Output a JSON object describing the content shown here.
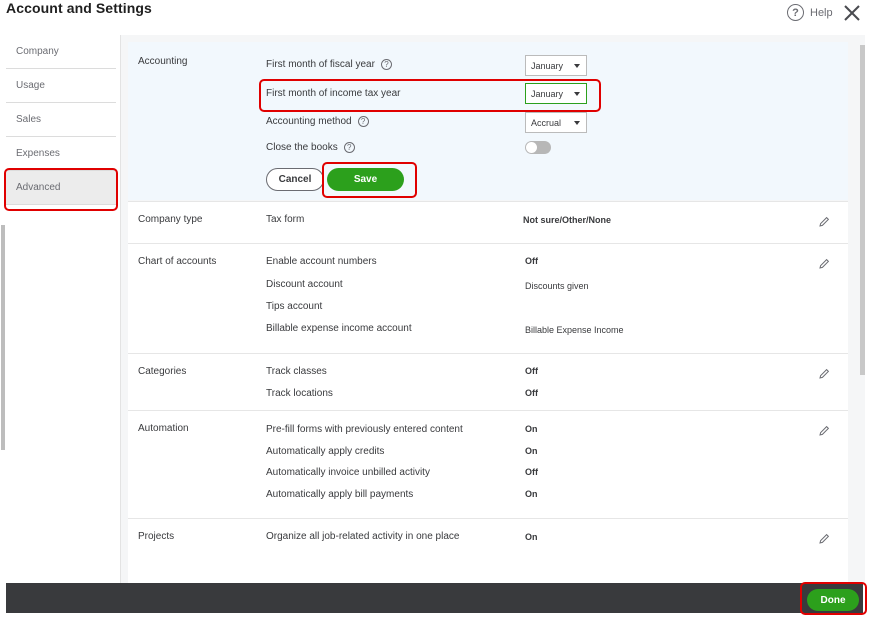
{
  "window": {
    "title": "Account and Settings",
    "help_label": "Help"
  },
  "sidebar": {
    "items": [
      {
        "label": "Company"
      },
      {
        "label": "Usage"
      },
      {
        "label": "Sales"
      },
      {
        "label": "Expenses"
      },
      {
        "label": "Advanced"
      }
    ]
  },
  "accounting": {
    "section_label": "Accounting",
    "fiscal_year_label": "First month of fiscal year",
    "fiscal_year_value": "January",
    "income_tax_label": "First month of income tax year",
    "income_tax_value": "January",
    "method_label": "Accounting method",
    "method_value": "Accrual",
    "close_books_label": "Close the books",
    "close_books_on": false,
    "cancel_label": "Cancel",
    "save_label": "Save"
  },
  "company_type": {
    "section_label": "Company type",
    "rows": [
      {
        "label": "Tax form",
        "value": "Not sure/Other/None"
      }
    ]
  },
  "chart_of_accounts": {
    "section_label": "Chart of accounts",
    "rows": [
      {
        "label": "Enable account numbers",
        "value": "Off"
      },
      {
        "label": "Discount account",
        "value": "Discounts given"
      },
      {
        "label": "Tips account",
        "value": ""
      },
      {
        "label": "Billable expense income account",
        "value": "Billable Expense Income"
      }
    ]
  },
  "categories": {
    "section_label": "Categories",
    "rows": [
      {
        "label": "Track classes",
        "value": "Off"
      },
      {
        "label": "Track locations",
        "value": "Off"
      }
    ]
  },
  "automation": {
    "section_label": "Automation",
    "rows": [
      {
        "label": "Pre-fill forms with previously entered content",
        "value": "On"
      },
      {
        "label": "Automatically apply credits",
        "value": "On"
      },
      {
        "label": "Automatically invoice unbilled activity",
        "value": "Off"
      },
      {
        "label": "Automatically apply bill payments",
        "value": "On"
      }
    ]
  },
  "projects": {
    "section_label": "Projects",
    "rows": [
      {
        "label": "Organize all job-related activity in one place",
        "value": "On"
      }
    ]
  },
  "footer": {
    "done_label": "Done"
  },
  "colors": {
    "accent_green": "#2ca01c",
    "highlight_red": "#e00000",
    "footer_bg": "#393a3d"
  }
}
